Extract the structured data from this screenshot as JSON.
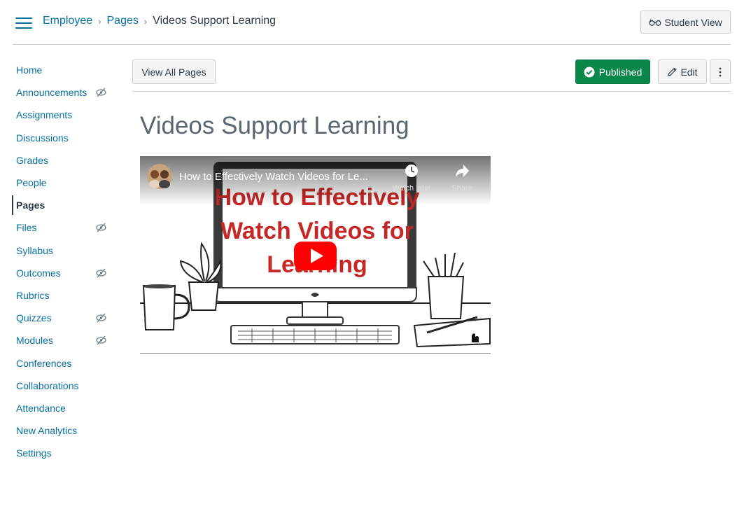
{
  "header": {
    "breadcrumb": [
      "Employee",
      "Pages",
      "Videos Support Learning"
    ],
    "student_view_label": "Student View"
  },
  "sidebar": {
    "items": [
      {
        "label": "Home",
        "hidden": false
      },
      {
        "label": "Announcements",
        "hidden": true
      },
      {
        "label": "Assignments",
        "hidden": false
      },
      {
        "label": "Discussions",
        "hidden": false
      },
      {
        "label": "Grades",
        "hidden": false
      },
      {
        "label": "People",
        "hidden": false
      },
      {
        "label": "Pages",
        "hidden": false,
        "active": true
      },
      {
        "label": "Files",
        "hidden": true
      },
      {
        "label": "Syllabus",
        "hidden": false
      },
      {
        "label": "Outcomes",
        "hidden": true
      },
      {
        "label": "Rubrics",
        "hidden": false
      },
      {
        "label": "Quizzes",
        "hidden": true
      },
      {
        "label": "Modules",
        "hidden": true
      },
      {
        "label": "Conferences",
        "hidden": false
      },
      {
        "label": "Collaborations",
        "hidden": false
      },
      {
        "label": "Attendance",
        "hidden": false
      },
      {
        "label": "New Analytics",
        "hidden": false
      },
      {
        "label": "Settings",
        "hidden": false
      }
    ]
  },
  "toolbar": {
    "view_all_label": "View All Pages",
    "published_label": "Published",
    "edit_label": "Edit"
  },
  "page": {
    "title": "Videos Support Learning"
  },
  "video": {
    "title": "How to Effectively Watch Videos for Le...",
    "watch_later_label": "Watch later",
    "share_label": "Share",
    "thumbnail_line1": "How to Effectively",
    "thumbnail_line2": "Watch Videos for",
    "thumbnail_line3": "Learning"
  },
  "colors": {
    "link": "#0770a3",
    "published": "#0b874b",
    "thumbnail_text": "#c62828",
    "play_button": "#ff0000"
  }
}
